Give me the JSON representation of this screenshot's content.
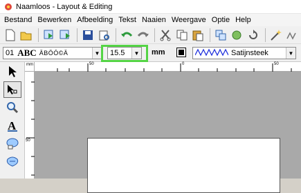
{
  "window": {
    "title": "Naamloos - Layout & Editing"
  },
  "menu": [
    "Bestand",
    "Bewerken",
    "Afbeelding",
    "Tekst",
    "Naaien",
    "Weergave",
    "Optie",
    "Help"
  ],
  "icons": {
    "title": "embroidery-app-icon",
    "toolbar1": [
      "new-icon",
      "open-icon",
      "import-icon",
      "export-icon",
      "save-icon",
      "print-preview-icon",
      "undo-icon",
      "redo-icon",
      "cut-icon",
      "copy-icon",
      "paste-icon",
      "duplicate-icon",
      "group-icon",
      "rotate-icon",
      "wizard-icon",
      "stitch-icon"
    ],
    "tools": [
      "select-arrow-icon",
      "point-edit-icon",
      "zoom-icon",
      "text-icon",
      "shape-icon",
      "stamp-icon"
    ]
  },
  "text_toolbar": {
    "font_number": "01",
    "font_preview": "ABC",
    "font_sample": "ÄBÖÓ©Ä",
    "size_value": "15.5",
    "unit": "mm",
    "stitch_type": "Satijnsteek"
  },
  "ruler": {
    "unit_label": "mm",
    "h_labels": [
      "50",
      "0",
      "50"
    ],
    "v_labels": [
      "50"
    ]
  },
  "colors": {
    "highlight": "#54d445",
    "canvas": "#a9a9a9",
    "stitch_line": "#2233dd"
  }
}
